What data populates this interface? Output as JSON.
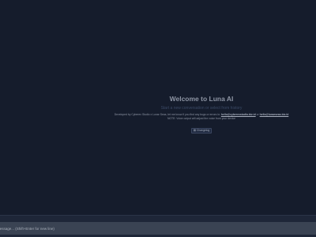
{
  "welcome": {
    "title": "Welcome to Luna AI",
    "subtitle": "Start a new conversation or select from history",
    "developer_prefix": "Developed by Cyberex Studio x Lunar Seas, let me know if you find any bugs or errors in:",
    "email_1": "hello@cyberexstudio.biz.id",
    "or_text": "or",
    "email_2": "hello@lunarseas.biz.id",
    "note": "NOTE: Voice output will adjust the voice from your device",
    "changelog_label": "Changelog",
    "changelog_icon": "document-icon"
  },
  "composer": {
    "placeholder": "message... (Shift+Enter for new line)"
  },
  "colors": {
    "background": "#151c2c",
    "bottom_bar": "#1e2638",
    "input_strip": "#3a4353",
    "title_text": "#8d94a3",
    "subtitle_text": "#3b4a66"
  }
}
